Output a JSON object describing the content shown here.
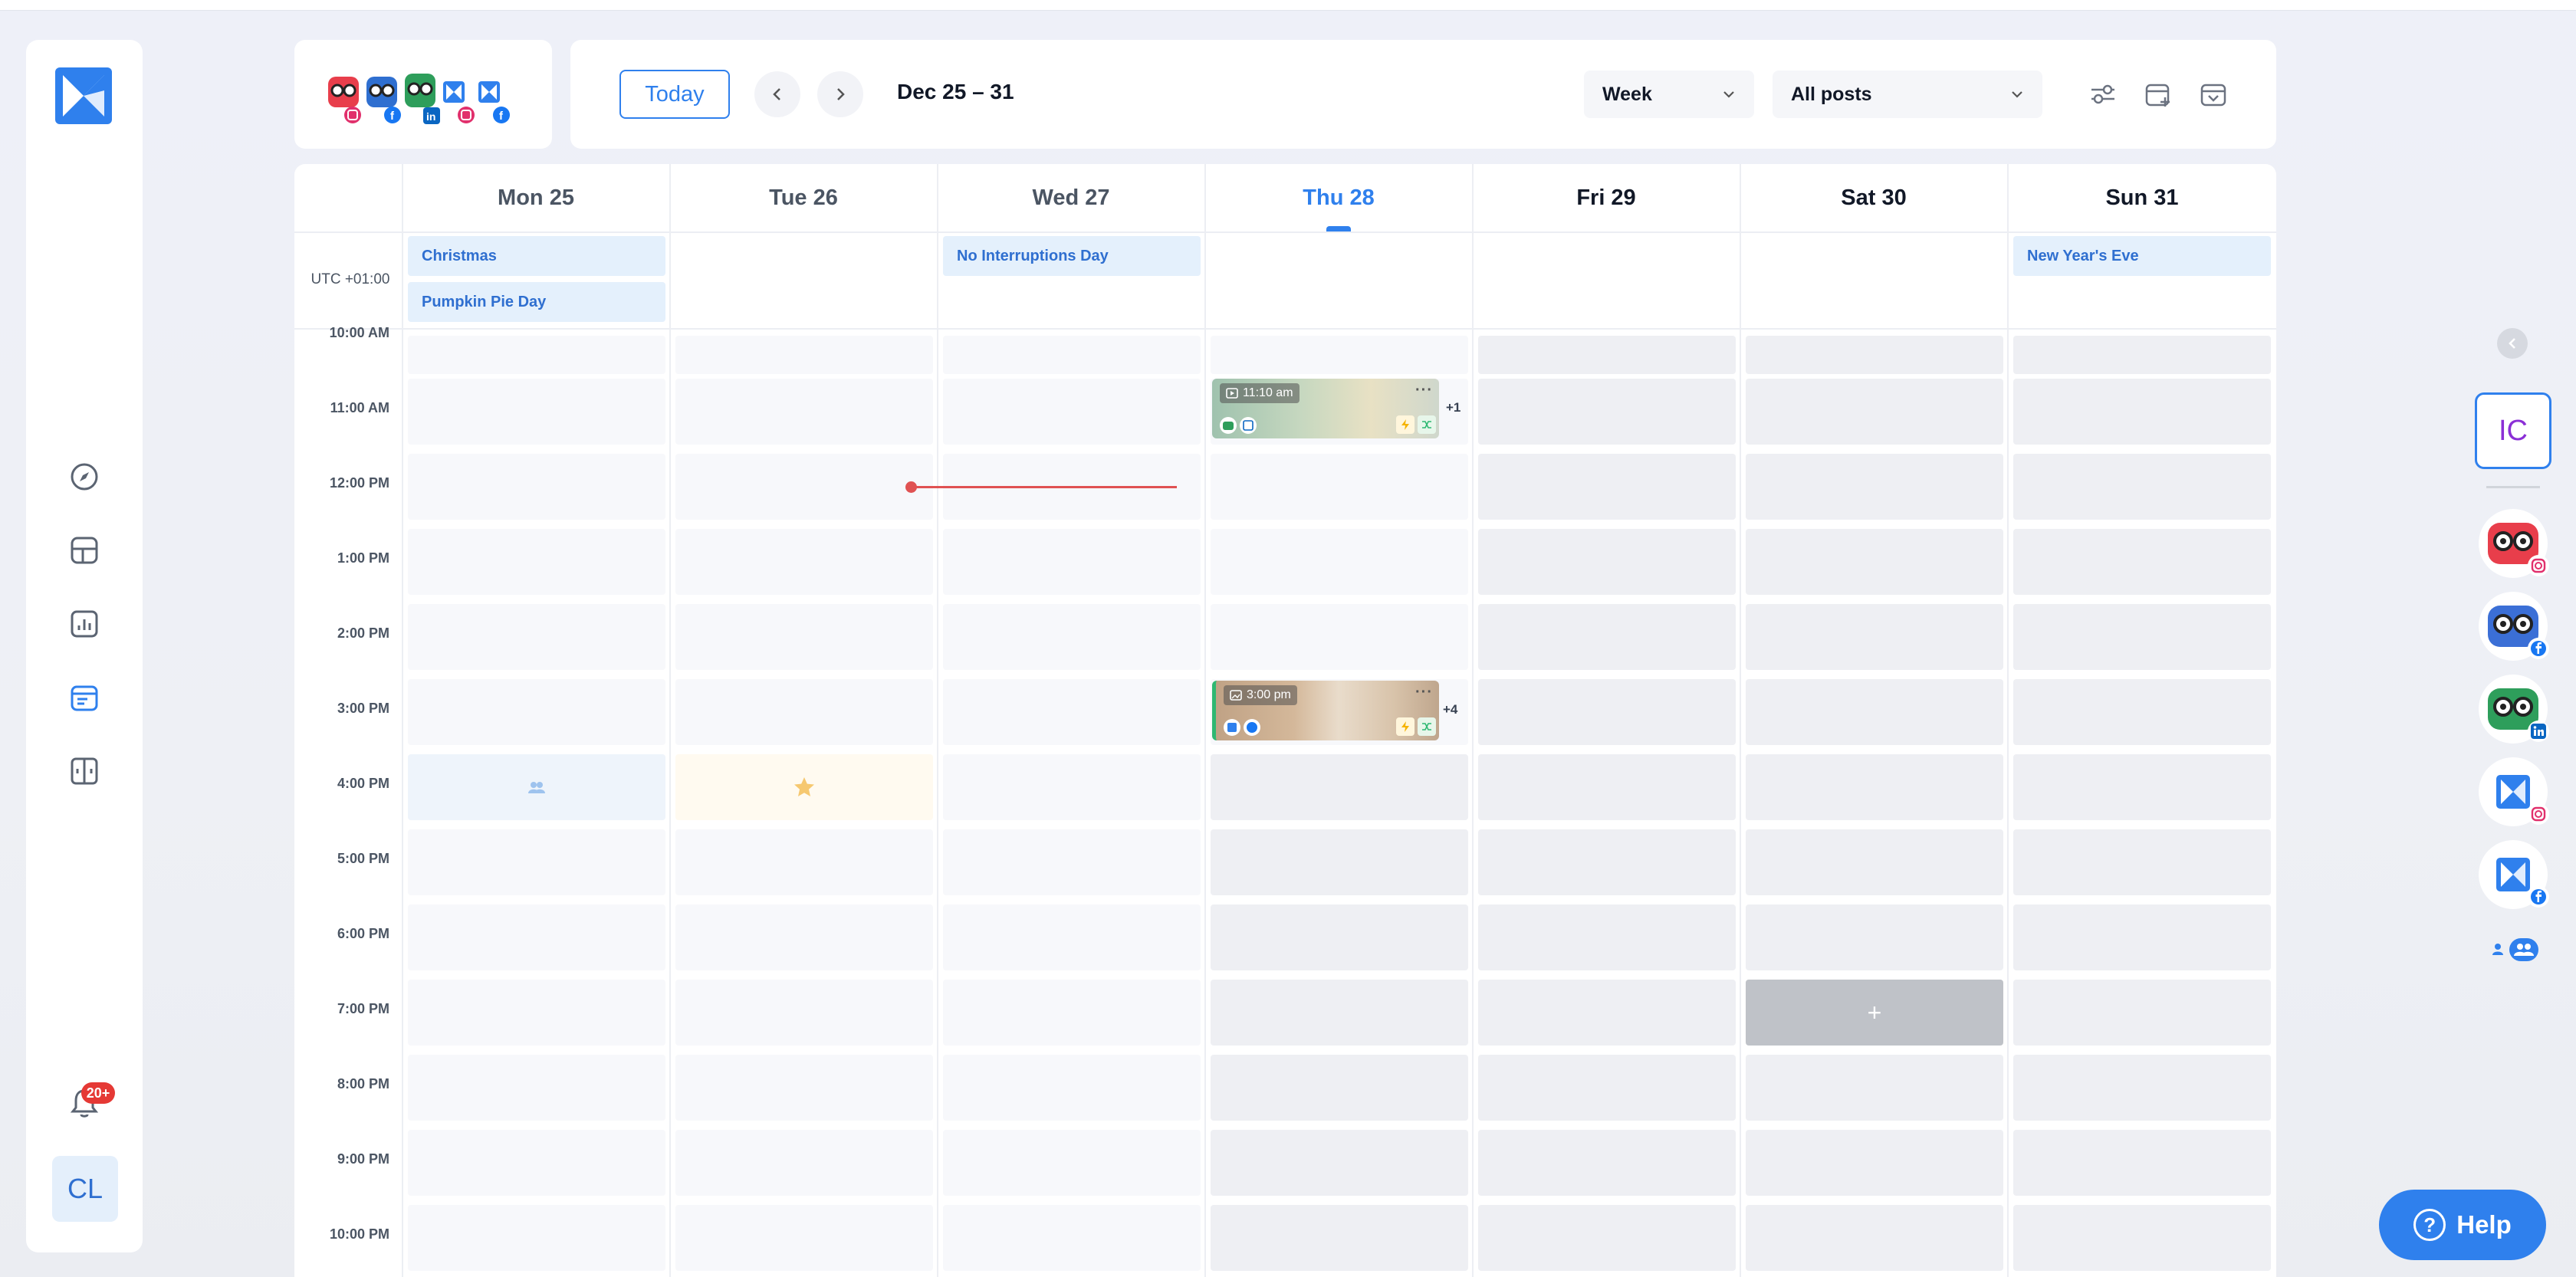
{
  "toolbar": {
    "today_label": "Today",
    "date_range": "Dec 25 – 31",
    "view_select": "Week",
    "filter_select": "All posts"
  },
  "calendar": {
    "timezone": "UTC +01:00",
    "days": [
      {
        "label": "Mon 25",
        "state": "past"
      },
      {
        "label": "Tue 26",
        "state": "past"
      },
      {
        "label": "Wed 27",
        "state": "past"
      },
      {
        "label": "Thu 28",
        "state": "today"
      },
      {
        "label": "Fri 29",
        "state": "future"
      },
      {
        "label": "Sat 30",
        "state": "future"
      },
      {
        "label": "Sun 31",
        "state": "future"
      }
    ],
    "holidays": {
      "mon_1": "Christmas",
      "mon_2": "Pumpkin Pie Day",
      "wed_1": "No Interruptions Day",
      "sun_1": "New Year's Eve"
    },
    "times": [
      "10:00 AM",
      "11:00 AM",
      "12:00 PM",
      "1:00 PM",
      "2:00 PM",
      "3:00 PM",
      "4:00 PM",
      "5:00 PM",
      "6:00 PM",
      "7:00 PM",
      "8:00 PM",
      "9:00 PM",
      "10:00 PM"
    ],
    "posts": [
      {
        "time": "11:10 am",
        "more": "+1"
      },
      {
        "time": "3:00 pm",
        "more": "+4"
      }
    ],
    "add_cell_label": "+"
  },
  "sidebar": {
    "notification_badge": "20+",
    "user_initials": "CL"
  },
  "right_rail": {
    "workspace_initials": "IC",
    "accounts": [
      {
        "avatar": "robot-red",
        "network": "instagram"
      },
      {
        "avatar": "robot-blue",
        "network": "facebook"
      },
      {
        "avatar": "robot-green",
        "network": "linkedin"
      },
      {
        "avatar": "brand-logo",
        "network": "instagram"
      },
      {
        "avatar": "brand-logo",
        "network": "facebook"
      }
    ]
  },
  "help": {
    "label": "Help",
    "icon": "?"
  },
  "colors": {
    "accent": "#2f80ed",
    "now_line": "#e05252",
    "workspace": "#8b2fd6"
  }
}
